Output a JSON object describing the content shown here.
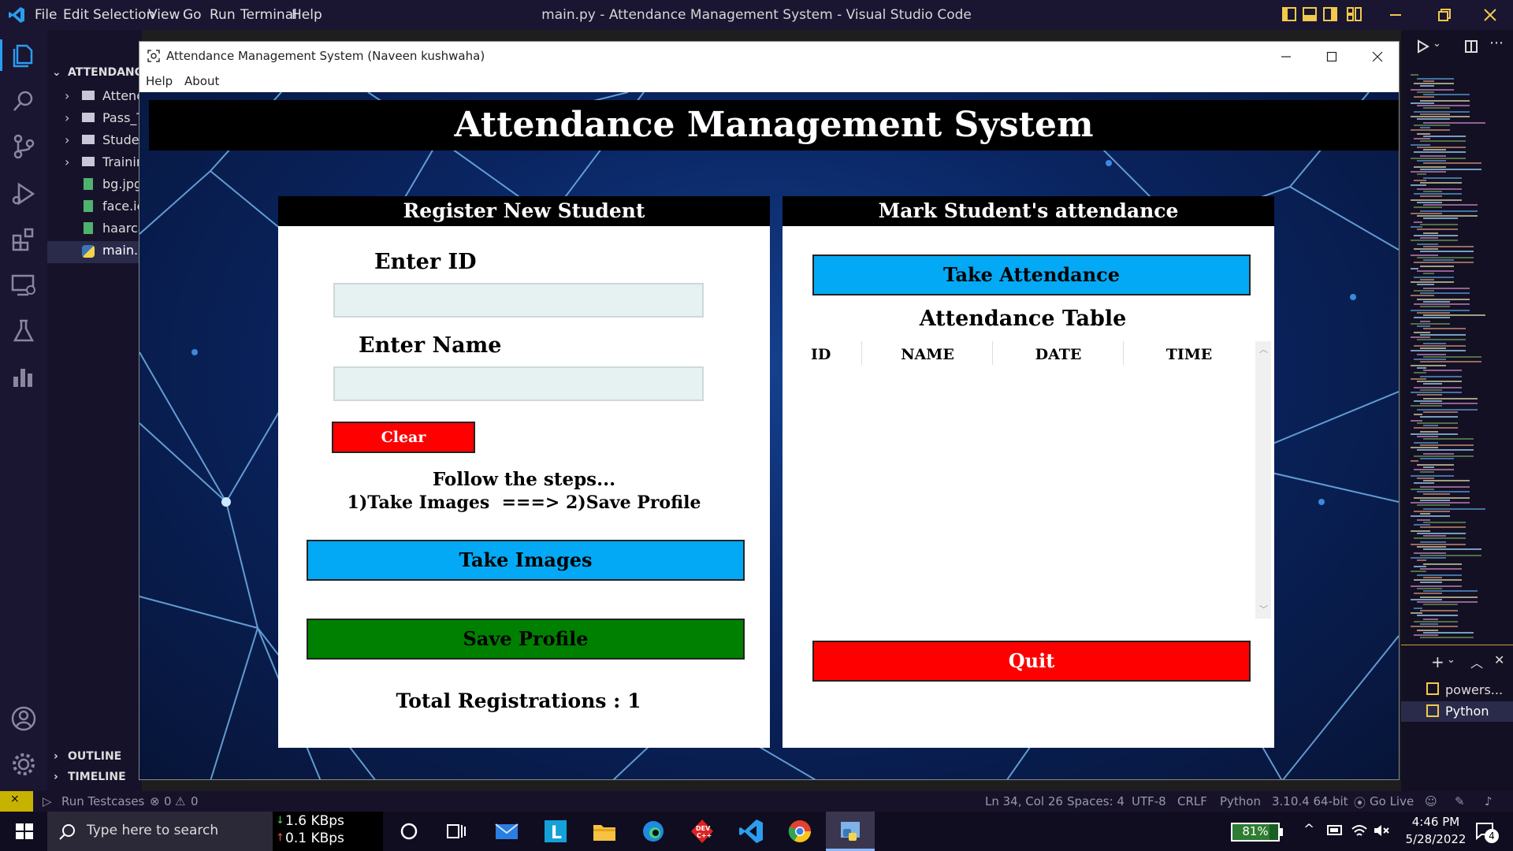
{
  "vscode": {
    "menu": [
      "File",
      "Edit",
      "Selection",
      "View",
      "Go",
      "Run",
      "Terminal",
      "Help"
    ],
    "window_title": "main.py - Attendance Management System - Visual Studio Code",
    "explorer": {
      "section": "ATTENDANCE",
      "items": [
        {
          "label": "Attenc",
          "kind": "folder"
        },
        {
          "label": "Pass_T",
          "kind": "folder"
        },
        {
          "label": "Studer",
          "kind": "folder"
        },
        {
          "label": "Trainin",
          "kind": "folder"
        },
        {
          "label": "bg.jpg",
          "kind": "image"
        },
        {
          "label": "face.ic",
          "kind": "image"
        },
        {
          "label": "haarca",
          "kind": "file"
        },
        {
          "label": "main.p",
          "kind": "python"
        }
      ],
      "outline": "OUTLINE",
      "timeline": "TIMELINE"
    },
    "terminal_tabs": [
      "powers...",
      "Python"
    ],
    "statusbar": {
      "run_testcases": "Run Testcases",
      "problems": "0",
      "warnings": "0",
      "cursor": "Ln 34, Col 26",
      "spaces": "Spaces: 4",
      "encoding": "UTF-8",
      "eol": "CRLF",
      "language": "Python",
      "interpreter": "3.10.4 64-bit",
      "golive": "Go Live"
    }
  },
  "app": {
    "window_title": "Attendance Management System (Naveen kushwaha)",
    "menu": [
      "Help",
      "About"
    ],
    "banner": "Attendance Management System",
    "register": {
      "heading": "Register New Student",
      "id_label": "Enter ID",
      "id_value": "",
      "name_label": "Enter Name",
      "name_value": "",
      "clear": "Clear",
      "steps_title": "Follow the steps...",
      "steps_text": "1)Take Images  ===> 2)Save Profile",
      "take_images": "Take Images",
      "save_profile": "Save Profile",
      "total": "Total Registrations : 1"
    },
    "attendance": {
      "heading": "Mark Student's attendance",
      "take_attendance": "Take Attendance",
      "table_title": "Attendance Table",
      "columns": [
        "ID",
        "NAME",
        "DATE",
        "TIME"
      ],
      "rows": [],
      "quit": "Quit"
    }
  },
  "taskbar": {
    "search_placeholder": "Type here to search",
    "net_down": "1.6 KBps",
    "net_up": "0.1 KBps",
    "battery": "81%",
    "time": "4:46 PM",
    "date": "5/28/2022",
    "notifications": "4"
  },
  "colors": {
    "blue_button": "#03a9f4",
    "green_button": "#008000",
    "red_button": "#ff0000"
  }
}
